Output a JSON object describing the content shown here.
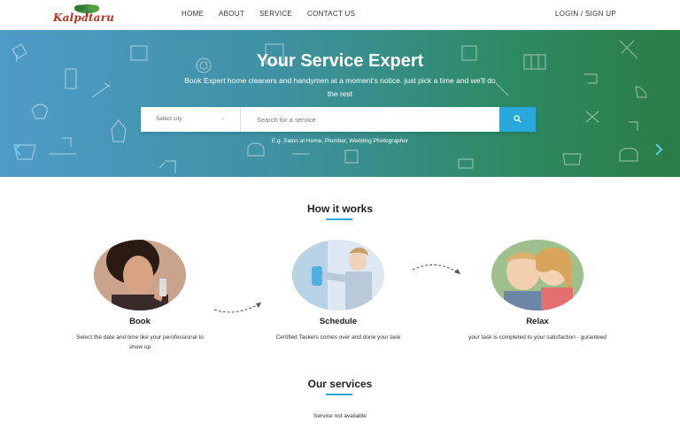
{
  "brand": {
    "logo_text": "Kalpataru"
  },
  "nav": {
    "home": "HOME",
    "about": "ABOUT",
    "service": "SERVICE",
    "contact": "CONTACT US",
    "login": "LOGIN / SIGN UP"
  },
  "hero": {
    "title": "Your Service Expert",
    "subtitle": "Book Expert home cleaners and handymen at a moment's notice. just pick a time and we'll do the rest",
    "city_placeholder": "Select city",
    "search_placeholder": "Search for a service",
    "example": "E.g. Salon at Home, Plumber, Wedding Photographer",
    "arrow_left_icon": "chevron-left-icon",
    "arrow_right_icon": "chevron-right-icon",
    "search_icon": "search-icon",
    "colors": {
      "gradient_start": "#4f9bc8",
      "gradient_end": "#2b7c45",
      "search_button": "#29a8dc"
    }
  },
  "how_it_works": {
    "title": "How it works",
    "steps": [
      {
        "title": "Book",
        "description": "Select the date and time like your perofessional to show up"
      },
      {
        "title": "Schedule",
        "description": "Certified Taskers comes over and done your task"
      },
      {
        "title": "Relax",
        "description": "your task is completed to your satisfaction - guranteed"
      }
    ]
  },
  "services": {
    "title": "Our services",
    "empty_message": "Service not available"
  },
  "accent_color": "#29a8dc"
}
